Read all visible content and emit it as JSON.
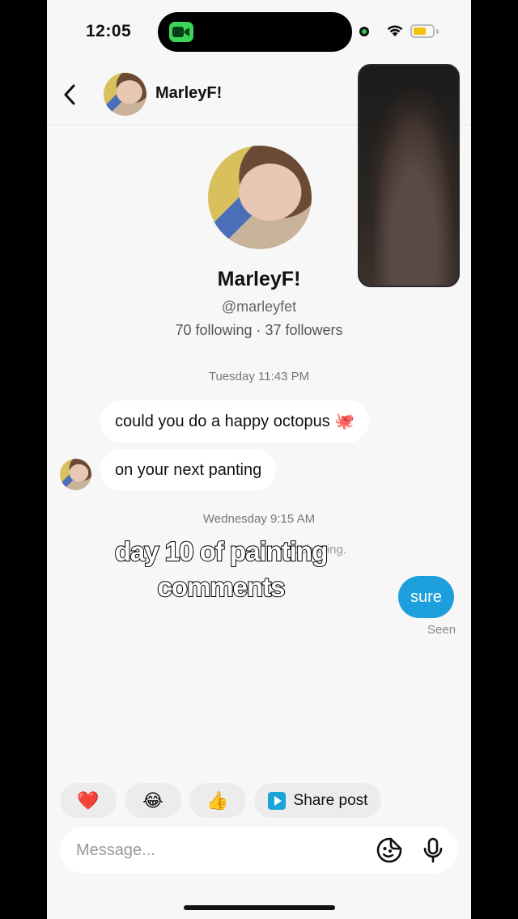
{
  "status_bar": {
    "time": "12:05",
    "battery_level": 0.7,
    "colors": {
      "call_pill": "#3bd45a",
      "battery": "#f5c10f"
    }
  },
  "header": {
    "name": "MarleyF!",
    "back_icon": "chevron-left-icon"
  },
  "profile": {
    "name": "MarleyF!",
    "handle": "@marleyfet",
    "stats": "70 following · 37 followers"
  },
  "conversation": {
    "timestamp_1": "Tuesday 11:43 PM",
    "incoming": [
      {
        "text": "could you do a happy octopus 🐙"
      },
      {
        "text": "on your next panting"
      }
    ],
    "timestamp_2": "Wednesday 9:15 AM",
    "system_note": "rt chatting.",
    "overlay_text": "day 10 of painting comments",
    "outgoing": [
      {
        "text": "sure"
      }
    ],
    "seen_label": "Seen"
  },
  "quick_replies": {
    "heart": "❤️",
    "laugh": "😂",
    "thumbs": "👍",
    "share_label": "Share post"
  },
  "composer": {
    "placeholder": "Message...",
    "sticker_icon": "sticker-icon",
    "mic_icon": "microphone-icon"
  },
  "colors": {
    "accent": "#1d9fdb",
    "background": "#f7f7f7"
  }
}
